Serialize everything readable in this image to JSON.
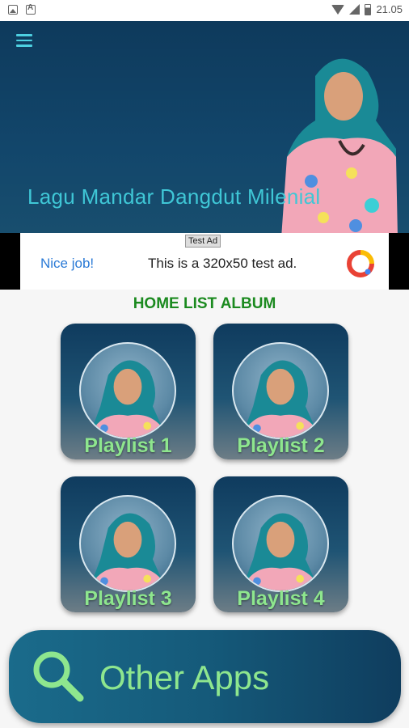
{
  "status_bar": {
    "time": "21.05"
  },
  "header": {
    "title": "Lagu Mandar Dangdut Milenial"
  },
  "ad": {
    "tag": "Test Ad",
    "nice": "Nice job!",
    "text": "This is a 320x50 test ad."
  },
  "section": {
    "title": "HOME LIST ALBUM"
  },
  "playlists": [
    {
      "label": "Playlist 1"
    },
    {
      "label": "Playlist 2"
    },
    {
      "label": "Playlist 3"
    },
    {
      "label": "Playlist 4"
    }
  ],
  "other_apps": {
    "label": "Other Apps"
  },
  "colors": {
    "accent": "#8ee68e",
    "title_green": "#1b8a1f",
    "header_title": "#3fc7d6"
  }
}
